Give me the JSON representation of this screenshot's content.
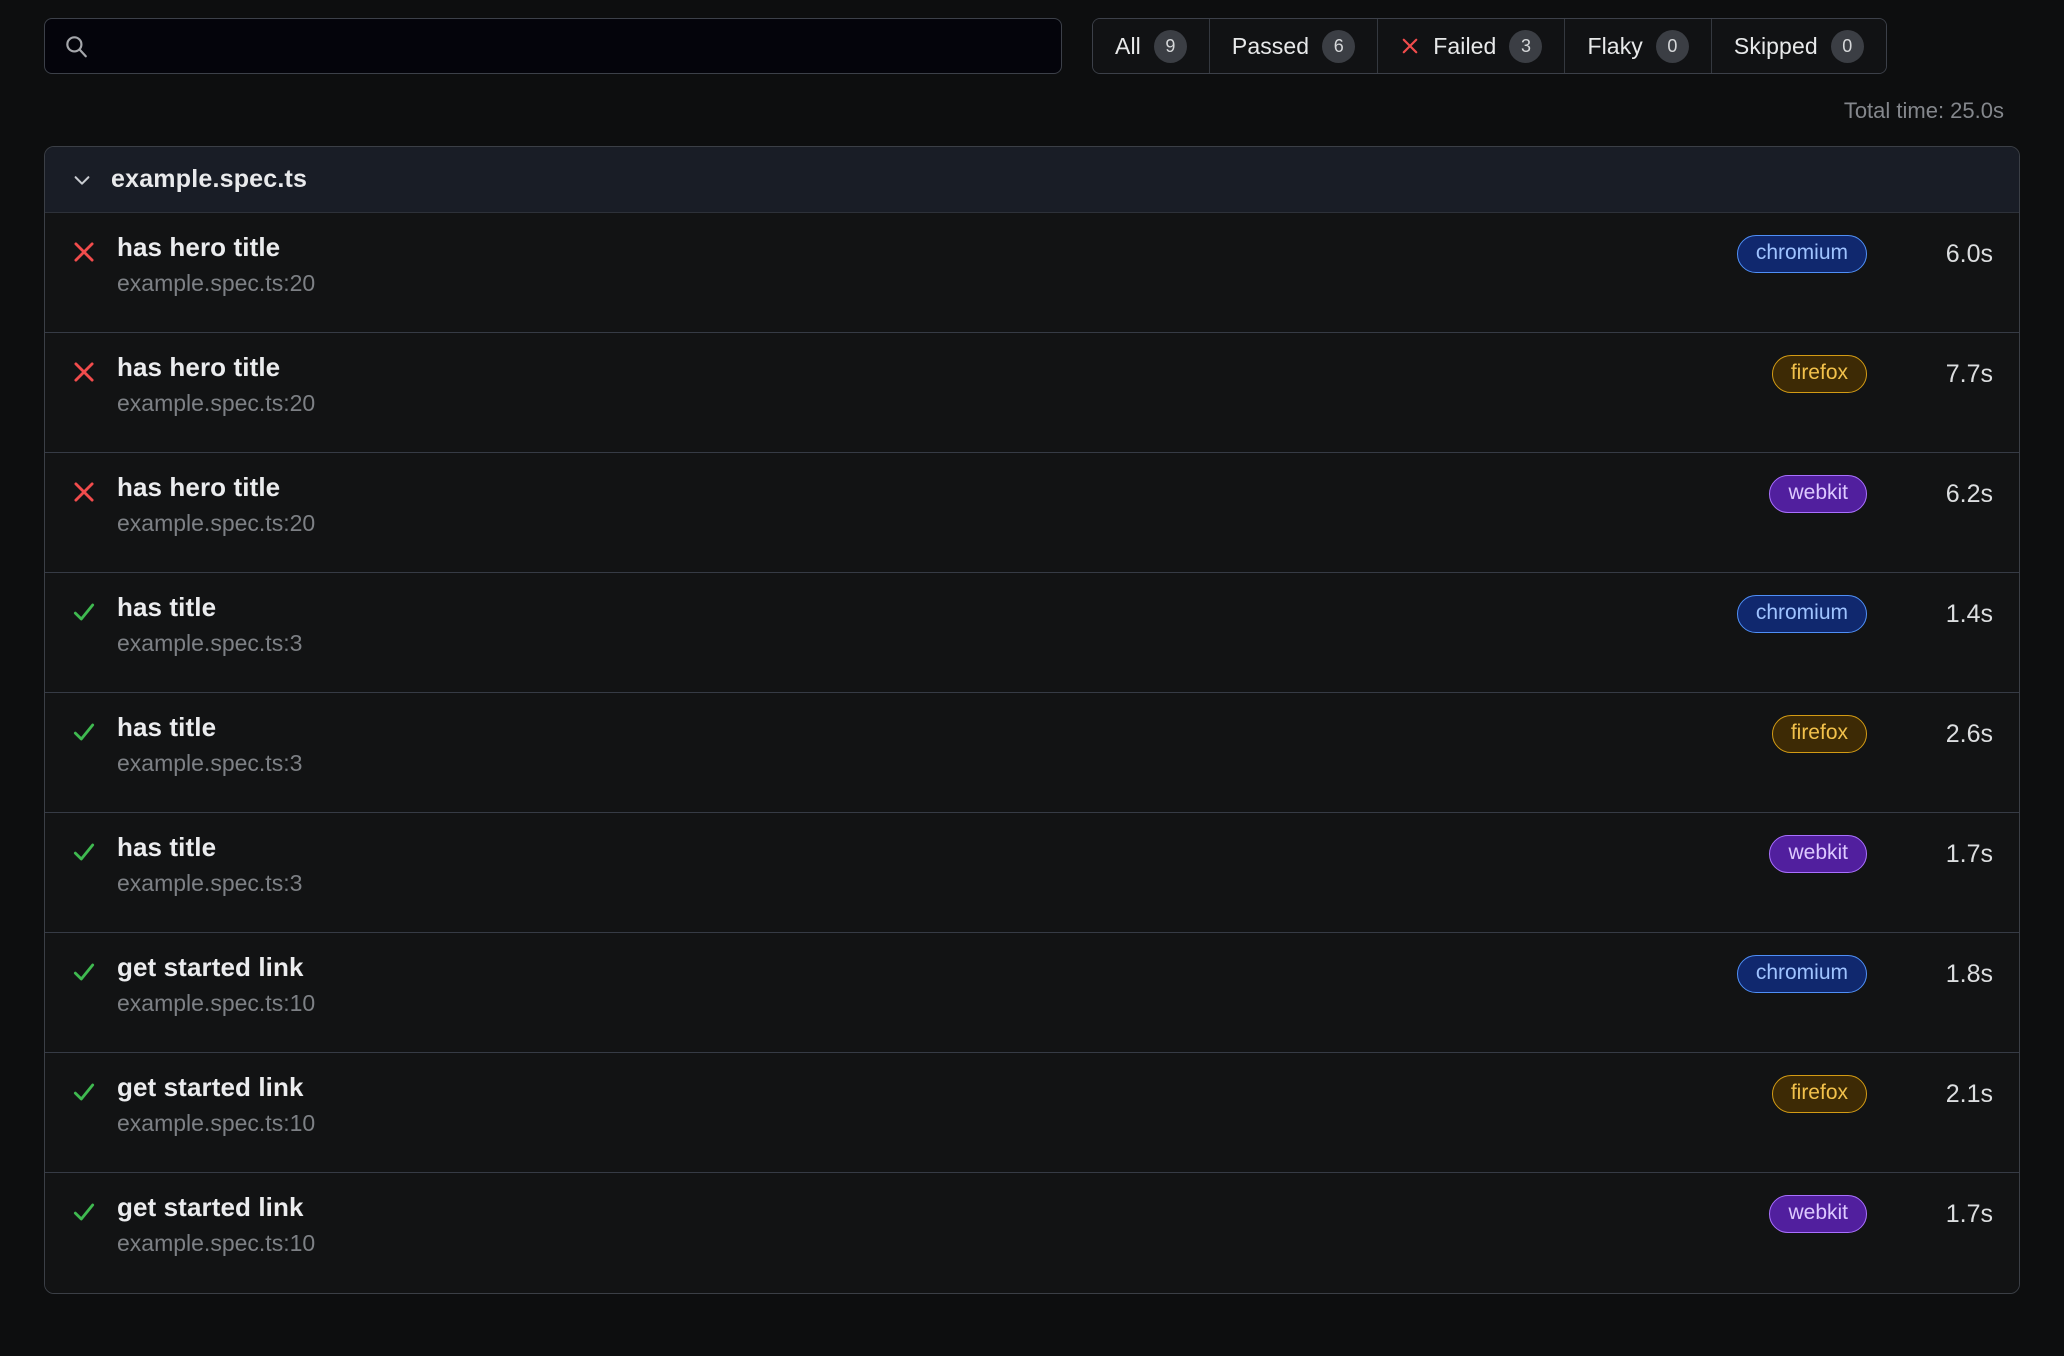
{
  "search": {
    "value": "",
    "placeholder": "",
    "icon": "search-icon"
  },
  "tabs": [
    {
      "label": "All",
      "count": "9",
      "icon": null,
      "selected": false
    },
    {
      "label": "Passed",
      "count": "6",
      "icon": null,
      "selected": false
    },
    {
      "label": "Failed",
      "count": "3",
      "icon": "x-mark-icon",
      "selected": false
    },
    {
      "label": "Flaky",
      "count": "0",
      "icon": null,
      "selected": false
    },
    {
      "label": "Skipped",
      "count": "0",
      "icon": null,
      "selected": false
    }
  ],
  "summary": {
    "total_time": "Total time: 25.0s"
  },
  "file_group": {
    "name": "example.spec.ts",
    "expanded": true,
    "chevron_icon": "chevron-down-icon"
  },
  "tests": [
    {
      "status": "failed",
      "status_icon": "x-mark-icon",
      "title": "has hero title",
      "location": "example.spec.ts:20",
      "project": "chromium",
      "duration": "6.0s"
    },
    {
      "status": "failed",
      "status_icon": "x-mark-icon",
      "title": "has hero title",
      "location": "example.spec.ts:20",
      "project": "firefox",
      "duration": "7.7s"
    },
    {
      "status": "failed",
      "status_icon": "x-mark-icon",
      "title": "has hero title",
      "location": "example.spec.ts:20",
      "project": "webkit",
      "duration": "6.2s"
    },
    {
      "status": "passed",
      "status_icon": "check-mark-icon",
      "title": "has title",
      "location": "example.spec.ts:3",
      "project": "chromium",
      "duration": "1.4s"
    },
    {
      "status": "passed",
      "status_icon": "check-mark-icon",
      "title": "has title",
      "location": "example.spec.ts:3",
      "project": "firefox",
      "duration": "2.6s"
    },
    {
      "status": "passed",
      "status_icon": "check-mark-icon",
      "title": "has title",
      "location": "example.spec.ts:3",
      "project": "webkit",
      "duration": "1.7s"
    },
    {
      "status": "passed",
      "status_icon": "check-mark-icon",
      "title": "get started link",
      "location": "example.spec.ts:10",
      "project": "chromium",
      "duration": "1.8s"
    },
    {
      "status": "passed",
      "status_icon": "check-mark-icon",
      "title": "get started link",
      "location": "example.spec.ts:10",
      "project": "firefox",
      "duration": "2.1s"
    },
    {
      "status": "passed",
      "status_icon": "check-mark-icon",
      "title": "get started link",
      "location": "example.spec.ts:10",
      "project": "webkit",
      "duration": "1.7s"
    }
  ],
  "colors": {
    "background": "#0d0e0f",
    "row_background": "#121314",
    "header_background": "#191d26",
    "border": "#3b3f46",
    "failed": "#f14c4c",
    "passed": "#3fb950",
    "muted_text": "#7d8085",
    "chromium": "#4f8ff7",
    "firefox": "#f2c14b",
    "webkit": "#a970ff"
  }
}
